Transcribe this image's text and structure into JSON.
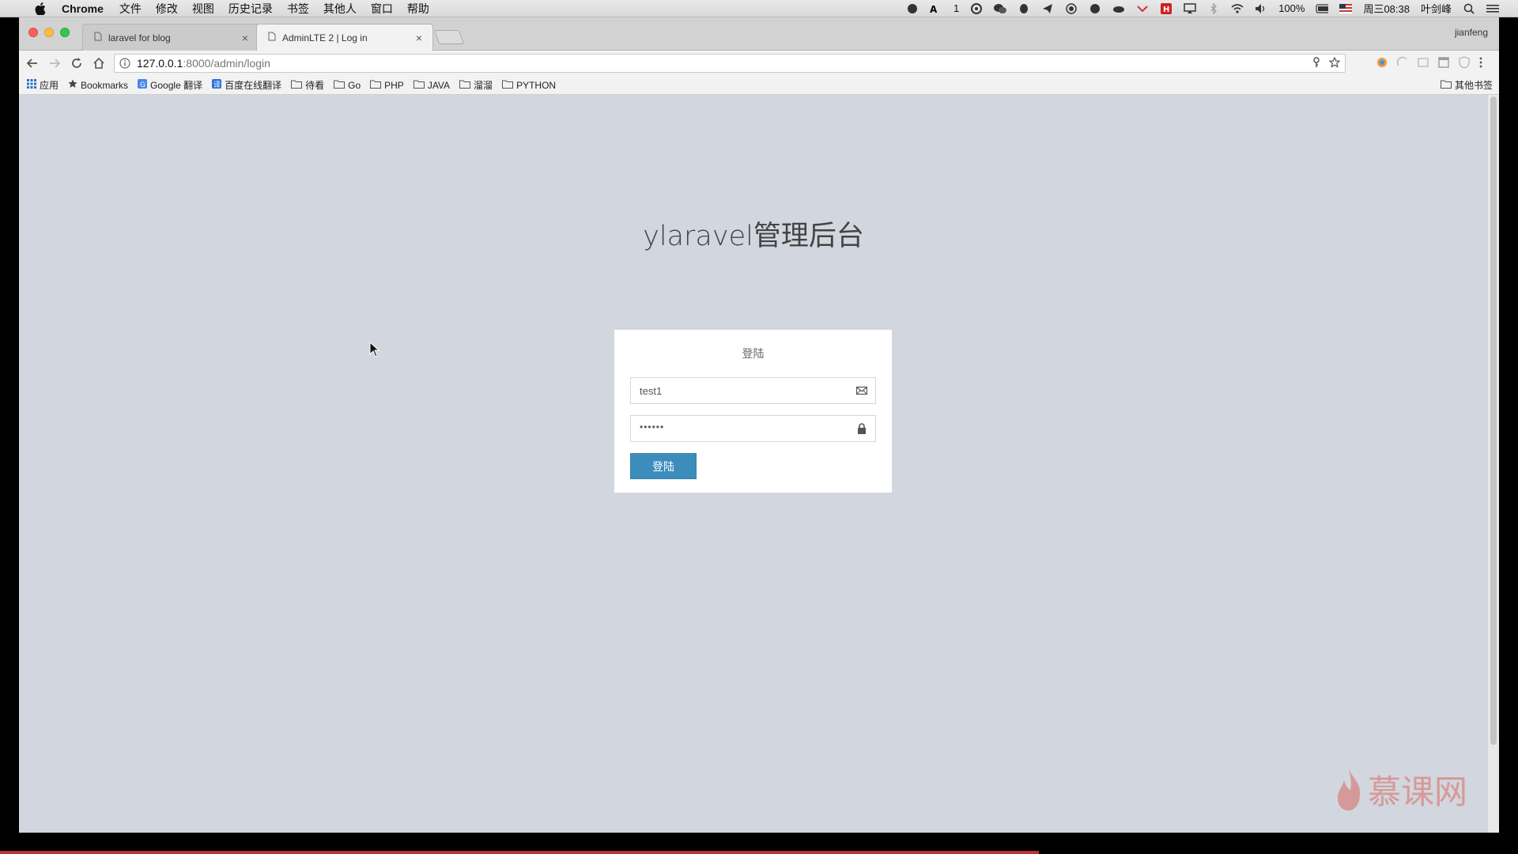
{
  "menubar": {
    "app_name": "Chrome",
    "menus": [
      "文件",
      "修改",
      "视图",
      "历史记录",
      "书签",
      "其他人",
      "窗口",
      "帮助"
    ],
    "tray": {
      "input_indicator": "1",
      "battery": "100%",
      "clock": "周三08:38",
      "user": "叶剑峰"
    }
  },
  "browser": {
    "tabs": [
      {
        "title": "laravel for blog",
        "active": false
      },
      {
        "title": "AdminLTE 2 | Log in",
        "active": true
      }
    ],
    "profile_name": "jianfeng",
    "address": {
      "host": "127.0.0.1",
      "path": ":8000/admin/login"
    },
    "bookmarks": [
      {
        "label": "应用",
        "icon": "apps-grid-icon"
      },
      {
        "label": "Bookmarks",
        "icon": "star-icon"
      },
      {
        "label": "Google 翻译",
        "icon": "google-translate-icon"
      },
      {
        "label": "百度在线翻译",
        "icon": "baidu-translate-icon"
      },
      {
        "label": "待看",
        "icon": "folder-icon"
      },
      {
        "label": "Go",
        "icon": "folder-icon"
      },
      {
        "label": "PHP",
        "icon": "folder-icon"
      },
      {
        "label": "JAVA",
        "icon": "folder-icon"
      },
      {
        "label": "溜溜",
        "icon": "folder-icon"
      },
      {
        "label": "PYTHON",
        "icon": "folder-icon"
      }
    ],
    "other_bookmarks": "其他书签"
  },
  "page": {
    "logo_text": "ylaravel管理后台",
    "login_box_msg": "登陆",
    "username_value": "test1",
    "password_mask": "••••••",
    "submit_label": "登陆"
  },
  "watermark": "慕课网",
  "colors": {
    "page_bg": "#d2d6de",
    "primary_button": "#3c8dbc"
  }
}
